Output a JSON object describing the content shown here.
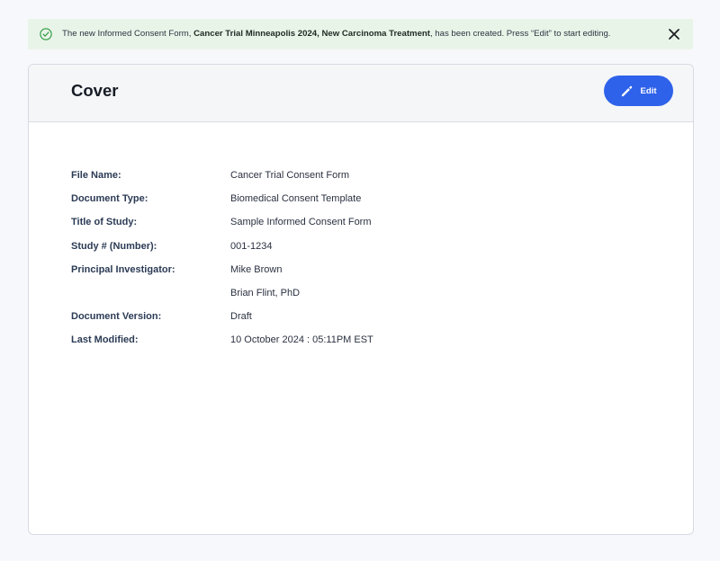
{
  "toast": {
    "prefix": "The new Informed Consent Form, ",
    "form_name": "Cancer Trial Minneapolis 2024, New Carcinoma Treatment",
    "suffix": ", has been created.  Press “Edit” to start editing.",
    "status_icon": "check-circle-icon",
    "close_icon": "close-icon",
    "accent_color": "#3aa14a"
  },
  "card": {
    "title": "Cover",
    "edit_label": "Edit",
    "edit_icon": "pencil-icon",
    "button_color": "#2f62ea"
  },
  "details": [
    {
      "label": "File Name:",
      "value": "Cancer Trial Consent Form"
    },
    {
      "label": "Document Type:",
      "value": "Biomedical Consent Template"
    },
    {
      "label": "Title of Study:",
      "value": "Sample Informed Consent Form"
    },
    {
      "label": "Study # (Number):",
      "value": "001-1234"
    },
    {
      "label": "Principal Investigator:",
      "value": "Mike Brown"
    },
    {
      "label": "",
      "value": "Brian Flint, PhD"
    },
    {
      "label": "Document Version:",
      "value": "Draft"
    },
    {
      "label": "Last Modified:",
      "value": "10 October 2024 : 05:11PM EST"
    }
  ]
}
